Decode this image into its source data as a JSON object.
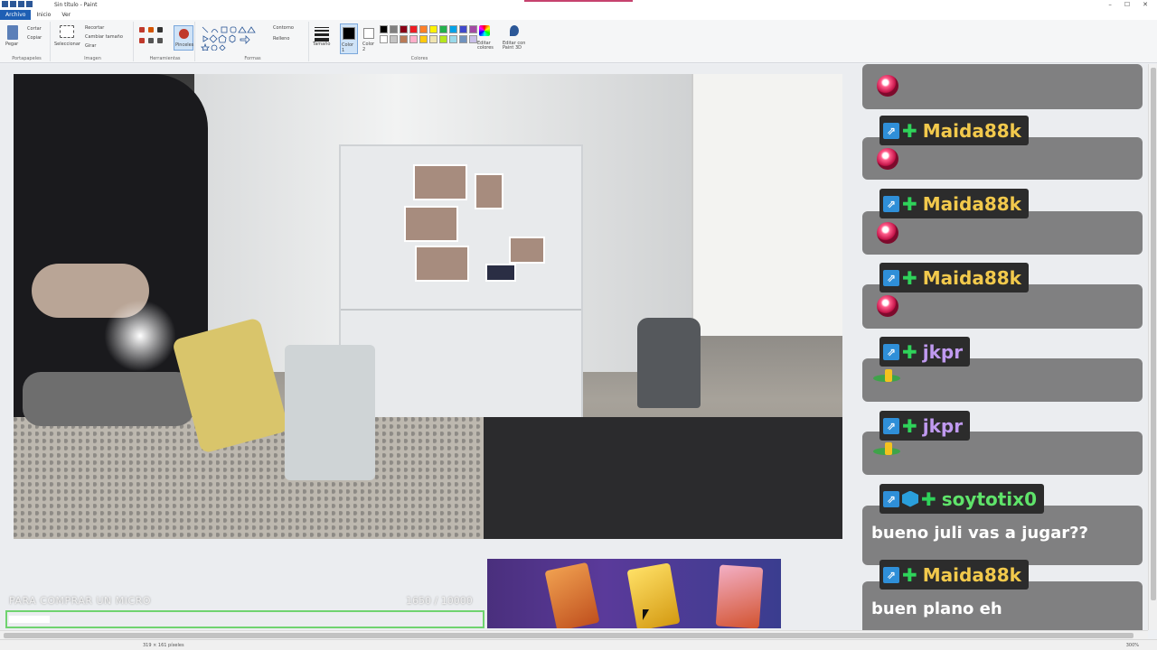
{
  "window": {
    "title": "Sin título - Paint",
    "controls": [
      "–",
      "☐",
      "✕"
    ]
  },
  "tabs": [
    "Archivo",
    "Inicio",
    "Ver"
  ],
  "ribbon": {
    "groups": [
      {
        "label": "Portapapeles",
        "items": [
          "Pegar",
          "Cortar",
          "Copiar"
        ]
      },
      {
        "label": "Imagen",
        "items": [
          "Seleccionar",
          "Recortar",
          "Cambiar tamaño",
          "Girar"
        ]
      },
      {
        "label": "Herramientas",
        "items": [
          "Pinceles"
        ]
      },
      {
        "label": "Formas",
        "items": [
          "Contorno",
          "Relleno"
        ]
      },
      {
        "label": "Colores",
        "items": [
          "Tamaño",
          "Color 1",
          "Color 2",
          "Editar colores",
          "Editar con Paint 3D"
        ]
      }
    ],
    "palette": [
      "#000000",
      "#7f7f7f",
      "#880015",
      "#ed1c24",
      "#ff7f27",
      "#fff200",
      "#22b14c",
      "#00a2e8",
      "#3f48cc",
      "#a349a4",
      "#ffffff",
      "#c3c3c3",
      "#b97a57",
      "#ffaec9",
      "#ffc90e",
      "#efe4b0",
      "#b5e61d",
      "#99d9ea",
      "#7092be",
      "#c8bfe7"
    ]
  },
  "goal": {
    "label": "PARA COMPRAR UN MICRO",
    "count": "1650  / 10000",
    "progress_fraction": 0.165
  },
  "chat": [
    {
      "user": "",
      "user_color": "#ffffff",
      "badges": [],
      "emote": "heart",
      "text": ""
    },
    {
      "user": "Maida88k",
      "user_color": "#f2c94c",
      "badges": [
        "prime-icon",
        "plus-icon"
      ],
      "emote": "heart",
      "text": ""
    },
    {
      "user": "Maida88k",
      "user_color": "#f2c94c",
      "badges": [
        "prime-icon",
        "plus-icon"
      ],
      "emote": "heart",
      "text": ""
    },
    {
      "user": "Maida88k",
      "user_color": "#f2c94c",
      "badges": [
        "prime-icon",
        "plus-icon"
      ],
      "emote": "heart",
      "text": ""
    },
    {
      "user": "jkpr",
      "user_color": "#c09af0",
      "badges": [
        "prime-icon",
        "plus-icon"
      ],
      "emote": "plant",
      "text": ""
    },
    {
      "user": "jkpr",
      "user_color": "#c09af0",
      "badges": [
        "prime-icon",
        "plus-icon"
      ],
      "emote": "plant",
      "text": ""
    },
    {
      "user": "soytotix0",
      "user_color": "#5fe36a",
      "badges": [
        "prime-icon",
        "cube-icon",
        "plus-icon"
      ],
      "emote": "",
      "text": "bueno juli vas a jugar??"
    },
    {
      "user": "Maida88k",
      "user_color": "#f2c94c",
      "badges": [
        "prime-icon",
        "plus-icon"
      ],
      "emote": "",
      "text": "buen plano eh"
    }
  ],
  "status": {
    "dimensions": "319 × 161 píxeles",
    "zoom": "300%"
  }
}
